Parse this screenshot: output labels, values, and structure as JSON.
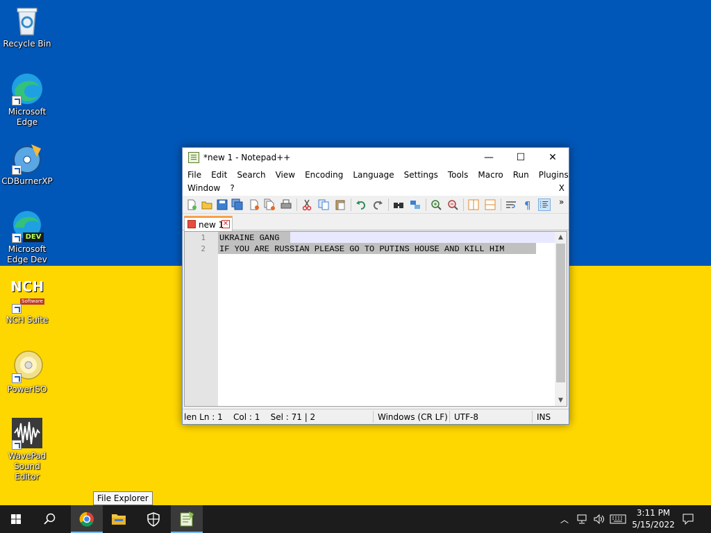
{
  "desktop": {
    "icons": [
      {
        "label": "Recycle Bin"
      },
      {
        "label": "Microsoft Edge"
      },
      {
        "label": "CDBurnerXP"
      },
      {
        "label": "Microsoft Edge Dev",
        "badge": "DEV"
      },
      {
        "label": "NCH Suite",
        "logo_text": "NCH",
        "logo_sub": "Software"
      },
      {
        "label": "PowerISO"
      },
      {
        "label": "WavePad Sound Editor"
      }
    ]
  },
  "window": {
    "title": "*new 1 - Notepad++",
    "controls": {
      "minimize": "—",
      "maximize": "☐",
      "close": "✕"
    },
    "menu_row1": [
      "File",
      "Edit",
      "Search",
      "View",
      "Encoding",
      "Language",
      "Settings",
      "Tools",
      "Macro",
      "Run",
      "Plugins"
    ],
    "menu_row2": [
      "Window",
      "?"
    ],
    "menu_close": "X",
    "toolbar_overflow": "»",
    "tab": {
      "label": "new 1",
      "close": "✕"
    },
    "lines": [
      {
        "num": "1",
        "text": "UKRAINE GANG"
      },
      {
        "num": "2",
        "text": "IF YOU ARE RUSSIAN PLEASE GO TO PUTINS HOUSE AND KILL HIM"
      }
    ],
    "status": {
      "position": "len Ln : 1    Col : 1    Sel : 71 | 2",
      "eol": "Windows (CR LF)",
      "encoding": "UTF-8",
      "mode": "INS"
    }
  },
  "tooltip": {
    "text": "File Explorer"
  },
  "taskbar": {
    "time": "3:11 PM",
    "date": "5/15/2022"
  },
  "colors": {
    "wallpaper_blue": "#0057b7",
    "wallpaper_yellow": "#ffd700",
    "taskbar": "#1c1c1c",
    "tab_accent": "#f7a14a"
  }
}
